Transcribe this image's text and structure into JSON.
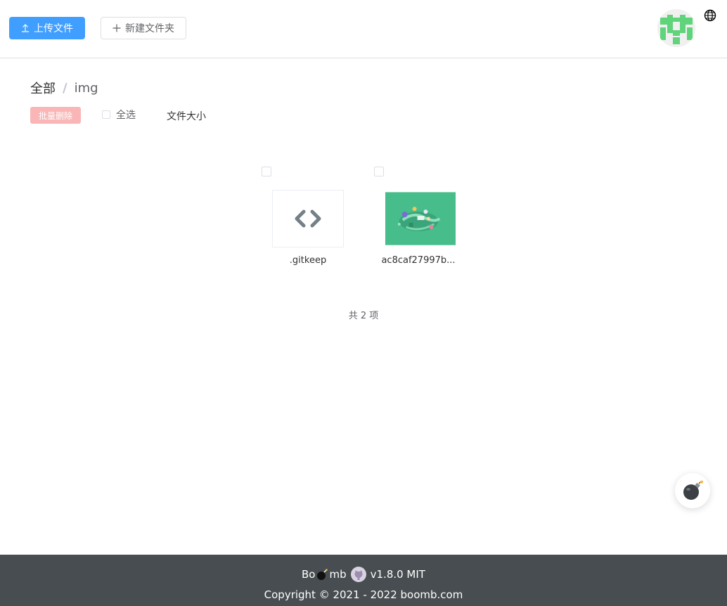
{
  "toolbar": {
    "upload_label": "上传文件",
    "new_folder_label": "新建文件夹"
  },
  "breadcrumb": {
    "root": "全部",
    "separator": "/",
    "current": "img"
  },
  "actions": {
    "batch_delete_label": "批量删除",
    "select_all_label": "全选",
    "sort_label": "文件大小"
  },
  "files": [
    {
      "name": ".gitkeep",
      "type": "code"
    },
    {
      "name": "ac8caf27997b...",
      "type": "image"
    }
  ],
  "total_text": "共 2 项",
  "footer": {
    "brand_prefix": "Bo",
    "brand_suffix": "mb",
    "version_text": "v1.8.0 MIT",
    "copyright": "Copyright © 2021 - 2022 boomb.com"
  },
  "colors": {
    "primary": "#409eff",
    "danger_light": "#fab6b6",
    "footer_bg": "#474d50",
    "avatar_green": "#5fd47a",
    "thumb_green": "#46bd8a"
  }
}
